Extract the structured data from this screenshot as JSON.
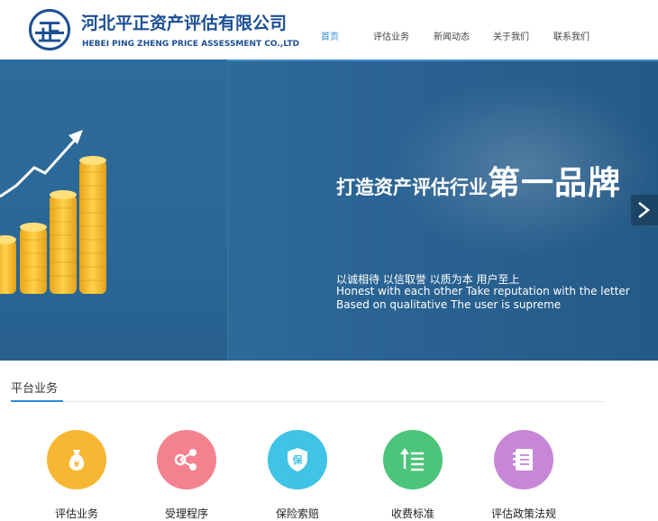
{
  "header": {
    "company_cn": "河北平正资产评估有限公司",
    "company_en": "HEBEI PING ZHENG PRICE ASSESSMENT CO.,LTD",
    "logo_glyph": "正"
  },
  "nav": {
    "items": [
      {
        "label": "首页",
        "active": true
      },
      {
        "label": "评估业务",
        "active": false
      },
      {
        "label": "新闻动态",
        "active": false
      },
      {
        "label": "关于我们",
        "active": false
      },
      {
        "label": "联系我们",
        "active": false
      }
    ]
  },
  "banner": {
    "slogan_small": "打造资产评估行业",
    "slogan_big": "第一品牌",
    "motto_cn": "以诚相待  以信取誉  以质为本  用户至上",
    "motto_en_1": "Honest with each other Take reputation with the letter",
    "motto_en_2": "Based on qualitative The user is supreme",
    "next_icon": "chevron-right-icon"
  },
  "section": {
    "title": "平台业务"
  },
  "services": [
    {
      "label": "评估业务",
      "color": "#f7b733",
      "icon": "money-bag-icon"
    },
    {
      "label": "受理程序",
      "color": "#f4828e",
      "icon": "share-nodes-icon"
    },
    {
      "label": "保险索赔",
      "color": "#3fc3e6",
      "icon": "shield-icon"
    },
    {
      "label": "收费标准",
      "color": "#4cc47a",
      "icon": "list-sort-icon"
    },
    {
      "label": "评估政策法规",
      "color": "#c787d6",
      "icon": "notebook-icon"
    }
  ],
  "colors": {
    "brand": "#1c4f93",
    "accent": "#2e8bd6",
    "banner": "#2a6393"
  }
}
